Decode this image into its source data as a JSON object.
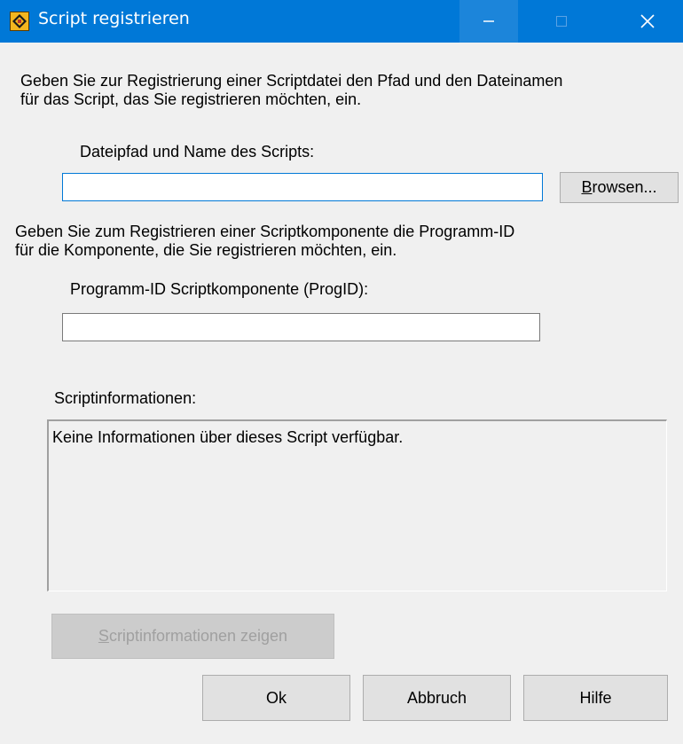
{
  "window": {
    "title": "Script registrieren",
    "controls": {
      "minimize": "—",
      "maximize": "☐",
      "close": "✕"
    }
  },
  "intro": {
    "line1": "Geben Sie zur Registrierung einer Scriptdatei den Pfad und den Dateinamen",
    "line2": "für das Script, das Sie registrieren möchten, ein."
  },
  "path_field": {
    "label": "Dateipfad und Name des Scripts:",
    "value": "",
    "browse_button": {
      "mnemonic": "B",
      "rest": "rowsen..."
    }
  },
  "component_intro": {
    "line1": "Geben Sie zum Registrieren einer Scriptkomponente die Programm-ID",
    "line2": "für die Komponente, die Sie registrieren möchten, ein."
  },
  "progid_field": {
    "label": "Programm-ID Scriptkomponente (ProgID):",
    "value": ""
  },
  "script_info": {
    "label": "Scriptinformationen:",
    "text": "Keine Informationen über dieses Script verfügbar."
  },
  "buttons": {
    "show_info": {
      "mnemonic": "S",
      "rest": "criptinformationen zeigen",
      "enabled": false
    },
    "ok": "Ok",
    "cancel": "Abbruch",
    "help": "Hilfe"
  },
  "colors": {
    "titlebar": "#0078d7",
    "dialog_bg": "#f0f0f0",
    "button_bg": "#e1e1e1",
    "focus_border": "#0078d7"
  }
}
